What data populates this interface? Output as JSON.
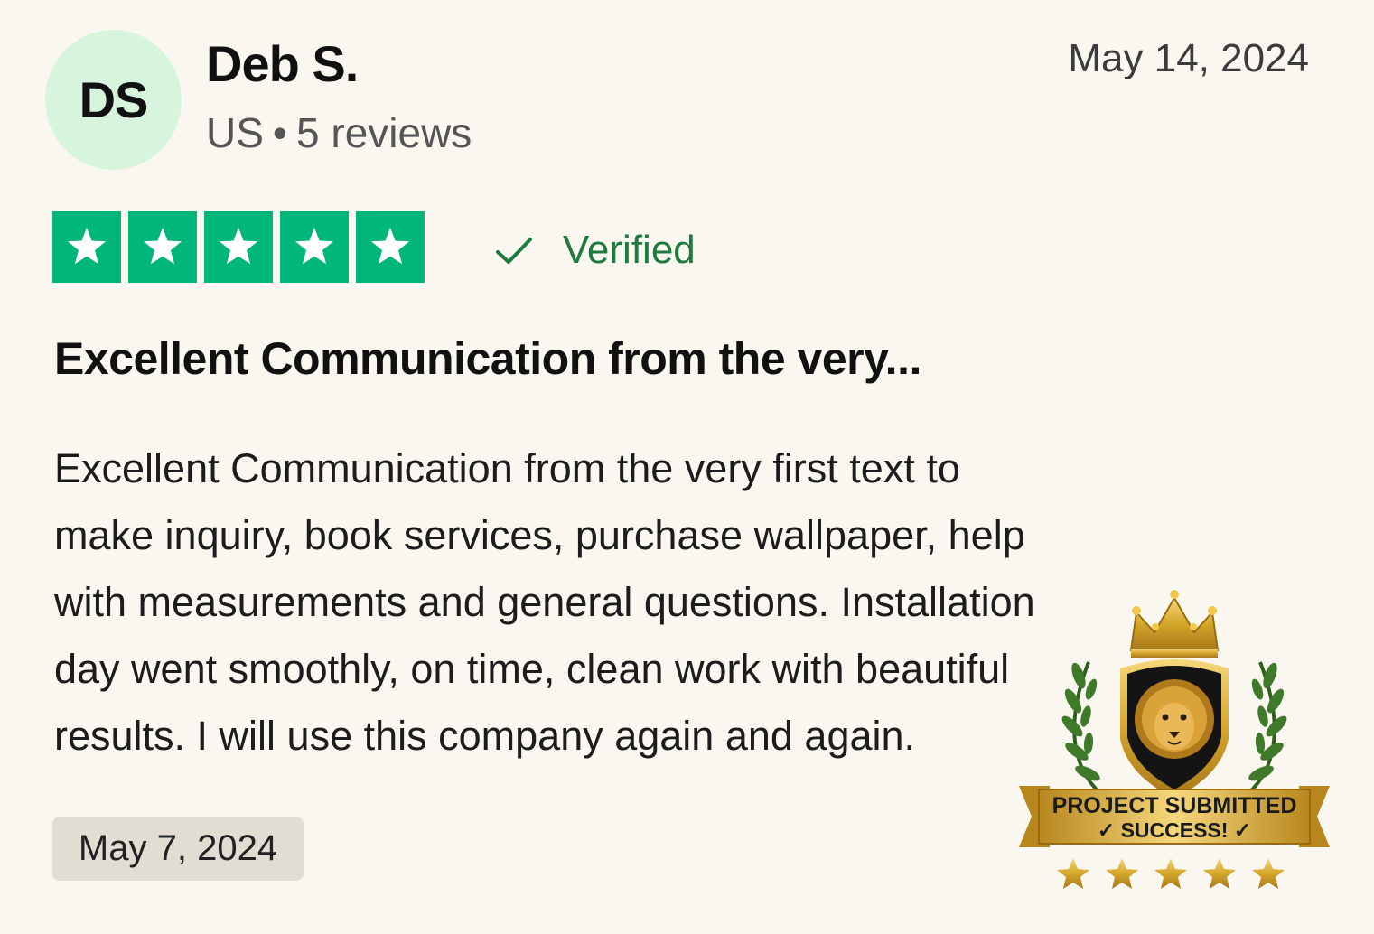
{
  "reviewer": {
    "initials": "DS",
    "name": "Deb S.",
    "country": "US",
    "reviews": "5 reviews"
  },
  "review": {
    "date_posted": "May 14, 2024",
    "rating": 5,
    "verified_label": "Verified",
    "title": "Excellent Communication from the very...",
    "body": "Excellent Communication from the very first text to make inquiry, book services, purchase wallpaper, help with measurements and general questions. Installation day went smoothly, on time, clean work with beautiful results. I will use this company again and again.",
    "experience_date": "May 7, 2024"
  },
  "badge": {
    "line1": "PROJECT SUBMITTED",
    "line2": "✓ SUCCESS! ✓",
    "stars": 5
  },
  "colors": {
    "star_green": "#00b67a",
    "verified_green": "#1e7a3e",
    "avatar_bg": "#d7f5dc",
    "gold": "#d4a62a"
  }
}
